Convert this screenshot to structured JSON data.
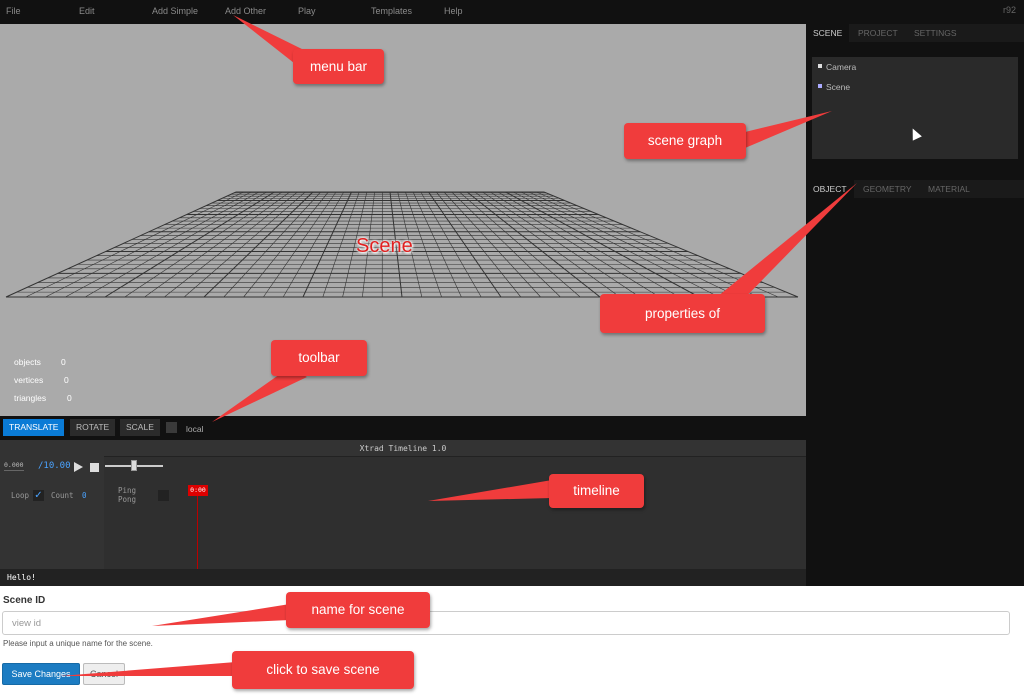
{
  "menu": {
    "items": [
      "File",
      "Edit",
      "Add Simple",
      "Add Other",
      "Play",
      "Templates",
      "Help"
    ],
    "revision": "r92"
  },
  "viewport": {
    "scene_label": "Scene",
    "info": [
      {
        "label": "objects",
        "value": "0"
      },
      {
        "label": "vertices",
        "value": "0"
      },
      {
        "label": "triangles",
        "value": "0"
      }
    ]
  },
  "toolbar": {
    "translate": "TRANSLATE",
    "rotate": "ROTATE",
    "scale": "SCALE",
    "local": "local"
  },
  "timeline": {
    "title": "Xtrad Timeline 1.0",
    "current_time": "0.000",
    "total_time": "/10.00",
    "loop_label": "Loop",
    "count_label": "Count",
    "count_value": "0",
    "pingpong_label": "Ping Pong",
    "marker": "0:00",
    "status": "Hello!"
  },
  "sidebar": {
    "scene_tabs": [
      "SCENE",
      "PROJECT",
      "SETTINGS"
    ],
    "outliner": [
      {
        "label": "Camera",
        "color": "#dddddd"
      },
      {
        "label": "Scene",
        "color": "#aaaaff"
      }
    ],
    "object_tabs": [
      "OBJECT",
      "GEOMETRY",
      "MATERIAL"
    ]
  },
  "form": {
    "scene_id_label": "Scene ID",
    "scene_id_placeholder": "view id",
    "help_text": "Please input a unique name for the scene.",
    "save_label": "Save Changes",
    "cancel_label": "Cancel"
  },
  "callouts": {
    "menu_bar": "menu bar",
    "scene_graph": "scene graph",
    "properties_of": "properties of",
    "toolbar": "toolbar",
    "timeline": "timeline",
    "name_for_scene": "name for scene",
    "click_to_save": "click to save scene"
  },
  "colors": {
    "accent": "#0a7bd6",
    "callout": "#f03c3c",
    "viewport": "#aaaaaa"
  }
}
